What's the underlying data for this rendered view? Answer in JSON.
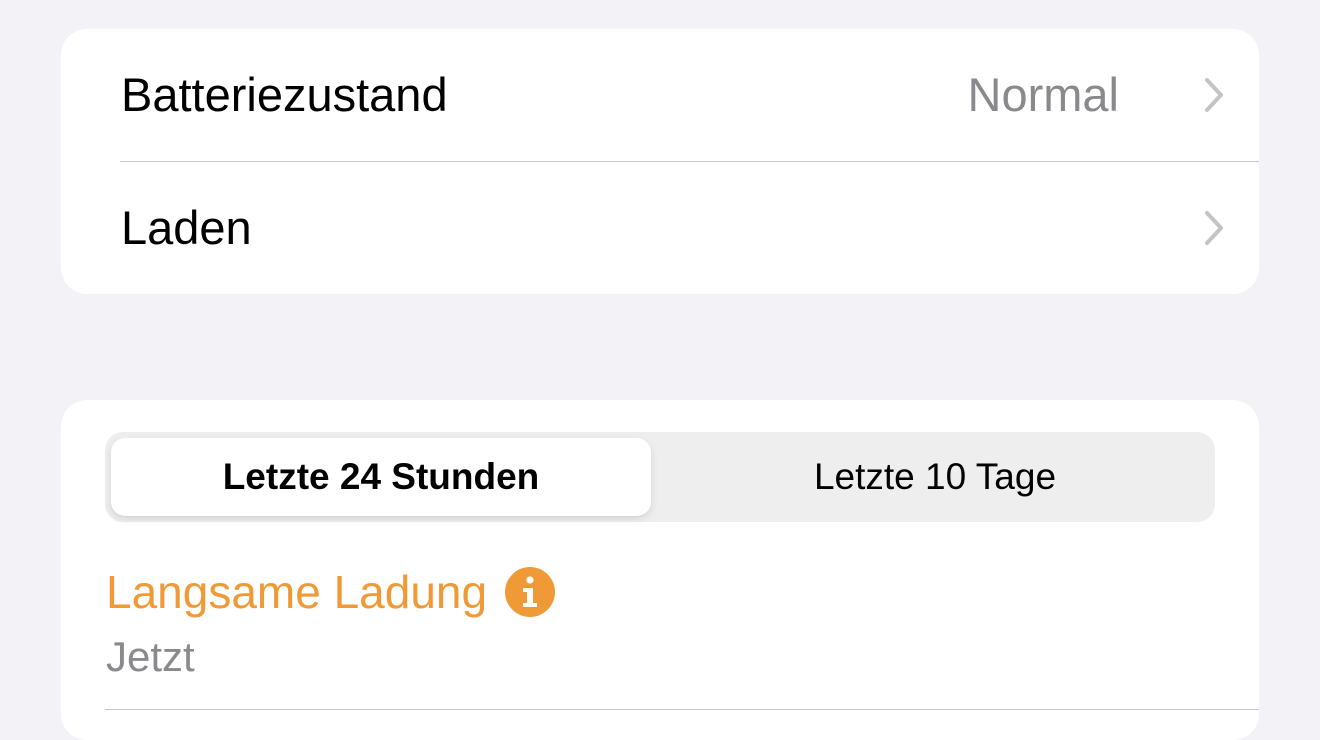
{
  "settings_group": {
    "rows": [
      {
        "label": "Batteriezustand",
        "value": "Normal",
        "icon": "chevron-right-icon"
      },
      {
        "label": "Laden",
        "value": "",
        "icon": "chevron-right-icon"
      }
    ]
  },
  "usage_section": {
    "segments": [
      {
        "label": "Letzte 24 Stunden",
        "selected": true
      },
      {
        "label": "Letzte 10 Tage",
        "selected": false
      }
    ],
    "status": {
      "title": "Langsame Ladung",
      "subtitle": "Jetzt",
      "icon": "info-icon",
      "accent_color": "#f09a37"
    }
  }
}
